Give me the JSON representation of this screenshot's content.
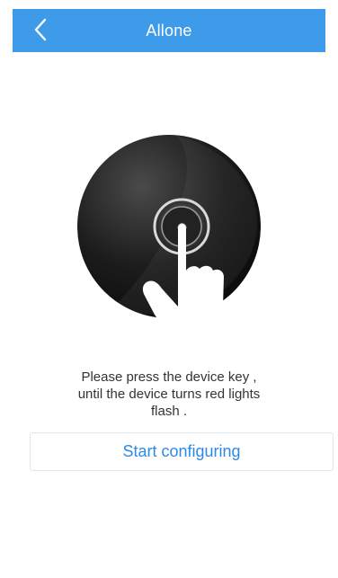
{
  "header": {
    "title": "Allone",
    "back_icon": "chevron-left-icon",
    "background_color": "#3d9be9"
  },
  "illustration": {
    "icon": "device-press-icon"
  },
  "instructions": {
    "lines": [
      "Please press the device key ,",
      "until the device turns red lights",
      "flash ."
    ]
  },
  "actions": {
    "start_label": "Start configuring",
    "accent_color": "#2c8ae6"
  }
}
